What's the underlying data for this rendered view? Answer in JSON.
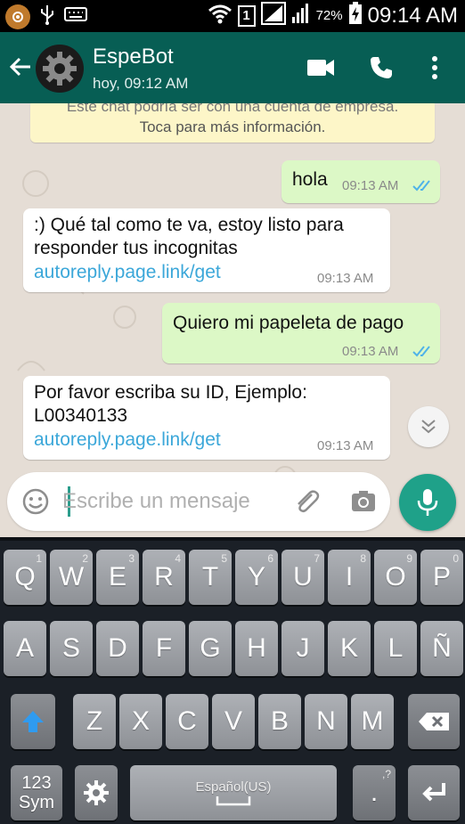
{
  "status_bar": {
    "sim": "1",
    "battery_percent": "72%",
    "time": "09:14 AM"
  },
  "header": {
    "contact_name": "EspeBot",
    "last_seen": "hoy, 09:12 AM",
    "icons": [
      "back-arrow-icon",
      "video-call-icon",
      "voice-call-icon",
      "more-options-icon"
    ]
  },
  "chat": {
    "system_notice": {
      "line1": "Este chat podría ser con una cuenta de empresa.",
      "line2": "Toca para más información."
    },
    "messages": [
      {
        "direction": "out",
        "text": "hola",
        "time": "09:13 AM",
        "status": "read"
      },
      {
        "direction": "in",
        "text_line1": ":) Qué tal como te va, estoy listo para",
        "text_line2": "responder tus incognitas",
        "link": "autoreply.page.link/get",
        "time": "09:13 AM"
      },
      {
        "direction": "out",
        "text": "Quiero mi papeleta de pago",
        "time": "09:13 AM",
        "status": "read"
      },
      {
        "direction": "in",
        "text_line1": "Por favor escriba su ID, Ejemplo:",
        "text_line2": "L00340133",
        "link": "autoreply.page.link/get",
        "time": "09:13 AM"
      }
    ]
  },
  "composer": {
    "placeholder": "Escribe un mensaje"
  },
  "keyboard": {
    "row1": [
      {
        "k": "Q",
        "s": "1"
      },
      {
        "k": "W",
        "s": "2"
      },
      {
        "k": "E",
        "s": "3"
      },
      {
        "k": "R",
        "s": "4"
      },
      {
        "k": "T",
        "s": "5"
      },
      {
        "k": "Y",
        "s": "6"
      },
      {
        "k": "U",
        "s": "7"
      },
      {
        "k": "I",
        "s": "8"
      },
      {
        "k": "O",
        "s": "9"
      },
      {
        "k": "P",
        "s": "0"
      }
    ],
    "row2": [
      "A",
      "S",
      "D",
      "F",
      "G",
      "H",
      "J",
      "K",
      "L",
      "Ñ"
    ],
    "row3": [
      "Z",
      "X",
      "C",
      "V",
      "B",
      "N",
      "M"
    ],
    "sym_line1": "123",
    "sym_line2": "Sym",
    "space_label": "Español(US)",
    "period_key": ".",
    "period_sub": ",?"
  },
  "colors": {
    "header": "#075e54",
    "outgoing_bubble": "#dcf8c6",
    "incoming_bubble": "#ffffff",
    "link": "#3ba7d9",
    "read_ticks": "#4fb3e8",
    "mic_button": "#1fa189"
  }
}
